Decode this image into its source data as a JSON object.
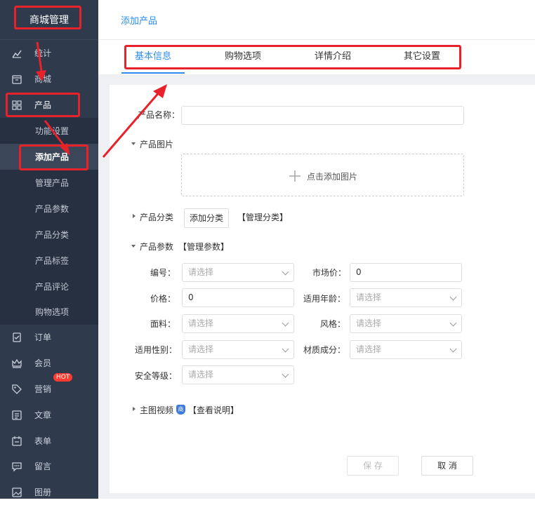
{
  "sidebar": {
    "logo": "商城管理",
    "items": [
      {
        "label": "统计",
        "icon": "chart-line-icon"
      },
      {
        "label": "商城",
        "icon": "store-icon"
      },
      {
        "label": "产品",
        "icon": "grid-icon"
      },
      {
        "label": "订单",
        "icon": "clipboard-icon"
      },
      {
        "label": "会员",
        "icon": "crown-icon"
      },
      {
        "label": "营销",
        "icon": "tag-icon"
      },
      {
        "label": "文章",
        "icon": "list-icon"
      },
      {
        "label": "表单",
        "icon": "calendar-icon"
      },
      {
        "label": "留言",
        "icon": "message-icon"
      },
      {
        "label": "图册",
        "icon": "image-icon"
      }
    ],
    "product_sub": [
      "功能设置",
      "添加产品",
      "管理产品",
      "产品参数",
      "产品分类",
      "产品标签",
      "产品评论",
      "购物选项"
    ],
    "hot_badge": "HOT"
  },
  "header": {
    "title": "添加产品"
  },
  "tabs": [
    "基本信息",
    "购物选项",
    "详情介绍",
    "其它设置"
  ],
  "form": {
    "name_label": "产品名称：",
    "image_label": "产品图片",
    "upload_text": "点击添加图片",
    "category_label": "产品分类",
    "add_category": "添加分类",
    "manage_category": "【管理分类】",
    "params_label": "产品参数",
    "manage_params": "【管理参数】",
    "fields": {
      "code": {
        "label": "编号：",
        "value": "请选择"
      },
      "market_price": {
        "label": "市场价：",
        "value": "0"
      },
      "price": {
        "label": "价格：",
        "value": "0"
      },
      "age": {
        "label": "适用年龄：",
        "value": "请选择"
      },
      "fabric": {
        "label": "面料：",
        "value": "请选择"
      },
      "style": {
        "label": "风格：",
        "value": "请选择"
      },
      "gender": {
        "label": "适用性别：",
        "value": "请选择"
      },
      "material": {
        "label": "材质成分：",
        "value": "请选择"
      },
      "safety": {
        "label": "安全等级：",
        "value": "请选择"
      }
    },
    "video_label": "主图视频",
    "video_badge": "商",
    "video_help": "【查看说明】",
    "save": "保 存",
    "cancel": "取 消"
  },
  "colors": {
    "sidebar": "#2f3a4c",
    "accent": "#2d8cf0",
    "annotation": "#e8222a"
  }
}
